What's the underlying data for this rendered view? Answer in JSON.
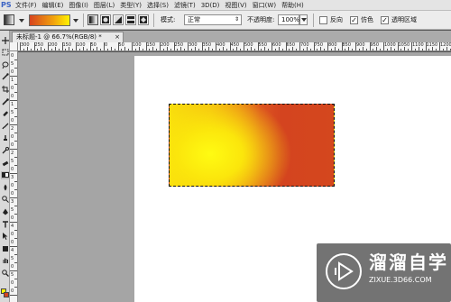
{
  "menubar": {
    "logo": "PS",
    "items": [
      "文件(F)",
      "编辑(E)",
      "图像(I)",
      "图层(L)",
      "类型(Y)",
      "选择(S)",
      "滤镜(T)",
      "3D(D)",
      "视图(V)",
      "窗口(W)",
      "帮助(H)"
    ]
  },
  "options": {
    "gradient_colors": [
      "#d7441f",
      "#f1a20d",
      "#fff200"
    ],
    "mode_label": "模式:",
    "mode_value": "正常",
    "opacity_label": "不透明度:",
    "opacity_value": "100%",
    "reverse_label": "反向",
    "reverse_checked": false,
    "dither_label": "仿色",
    "dither_checked": true,
    "transparency_label": "透明区域",
    "transparency_checked": true,
    "check_mark": "✓"
  },
  "document": {
    "tab_title": "未标题-1 @ 66.7%(RGB/8) *",
    "close_glyph": "×"
  },
  "ruler": {
    "h_labels": [
      "300",
      "250",
      "200",
      "150",
      "100",
      "50",
      "0",
      "50",
      "100",
      "150",
      "200",
      "250",
      "300",
      "350",
      "400",
      "450",
      "500",
      "550",
      "600",
      "650",
      "700",
      "750",
      "800",
      "850",
      "900",
      "950",
      "1000",
      "1050",
      "1100",
      "1150",
      "1200",
      "1250"
    ],
    "v_labels": [
      "0",
      "5",
      "0",
      "1",
      "0",
      "0",
      "1",
      "5",
      "0",
      "2",
      "0",
      "0",
      "2",
      "5",
      "0",
      "3",
      "0",
      "0",
      "3",
      "5",
      "0",
      "4",
      "0",
      "0",
      "4",
      "5",
      "0",
      "5",
      "0",
      "0"
    ]
  },
  "canvas": {
    "fill_colors": [
      "#fff200",
      "#f3b612",
      "#d4441f"
    ]
  },
  "watermark": {
    "brand": "溜溜自学",
    "url": "ZIXUE.3D66.COM"
  },
  "tools": [
    "move-icon",
    "marquee-icon",
    "lasso-icon",
    "quick-select-icon",
    "crop-icon",
    "eyedropper-icon",
    "healing-brush-icon",
    "brush-icon",
    "clone-stamp-icon",
    "history-brush-icon",
    "eraser-icon",
    "gradient-icon",
    "blur-icon",
    "dodge-icon",
    "pen-icon",
    "type-icon",
    "path-select-icon",
    "shape-icon",
    "hand-icon",
    "zoom-icon"
  ]
}
